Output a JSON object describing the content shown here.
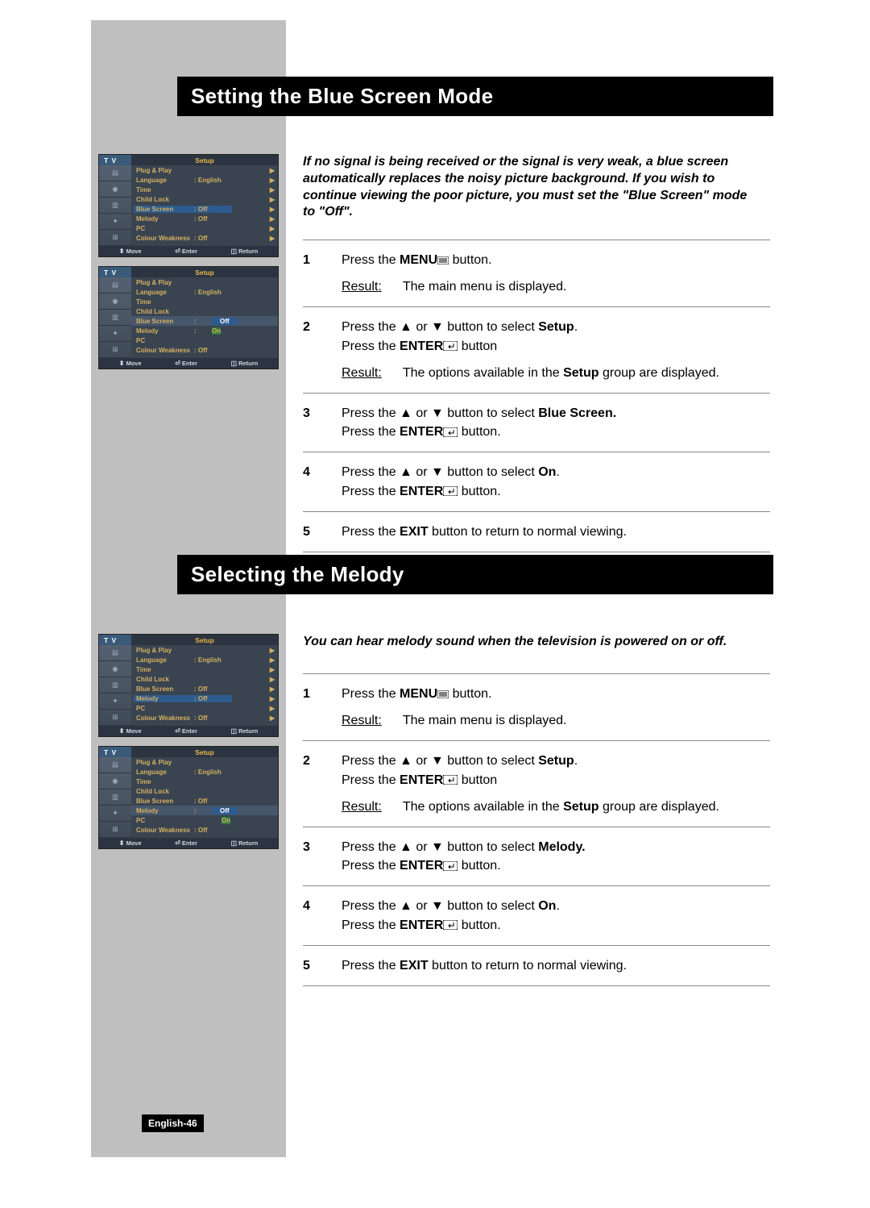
{
  "section1": {
    "title": "Setting the Blue Screen Mode",
    "intro": "If no signal is being received or the signal is very weak, a blue screen automatically replaces the noisy picture background.\nIf you wish to continue viewing the poor picture, you must set the \"Blue Screen\" mode to \"Off\".",
    "steps": {
      "s1_a": "Press the ",
      "s1_menu": "MENU",
      "s1_b": " button.",
      "s1_result_label": "Result",
      "s1_result": "The main menu is displayed.",
      "s2_a": "Press the ▲ or ▼ button to select ",
      "s2_setup": "Setup",
      "s2_b": ".\nPress the ",
      "s2_enter": "ENTER",
      "s2_c": " button",
      "s2_result_label": "Result",
      "s2_result_a": "The options available in the ",
      "s2_result_b": "Setup",
      "s2_result_c": " group are displayed.",
      "s3_a": "Press the ▲ or ▼ button to select ",
      "s3_b": "Blue Screen.",
      "s3_c": "\nPress the ",
      "s3_enter": "ENTER",
      "s3_d": " button.",
      "s4_a": "Press the ▲ or ▼ button to select ",
      "s4_b": "On",
      "s4_c": ".\nPress the ",
      "s4_enter": "ENTER",
      "s4_d": " button.",
      "s5_a": "Press the ",
      "s5_b": "EXIT",
      "s5_c": " button to return to normal viewing."
    }
  },
  "section2": {
    "title": "Selecting the Melody",
    "intro": "You can hear melody sound when the television is powered on or off.",
    "steps": {
      "s1_a": "Press the ",
      "s1_menu": "MENU",
      "s1_b": " button.",
      "s1_result_label": "Result",
      "s1_result": "The main menu is displayed.",
      "s2_a": "Press the ▲ or ▼ button to select ",
      "s2_setup": "Setup",
      "s2_b": ".\nPress the ",
      "s2_enter": "ENTER",
      "s2_c": " button",
      "s2_result_label": "Result",
      "s2_result_a": "The options available in the ",
      "s2_result_b": "Setup",
      "s2_result_c": " group are displayed.",
      "s3_a": "Press the ▲ or ▼ button to select ",
      "s3_b": "Melody.",
      "s3_c": "\nPress the ",
      "s3_enter": "ENTER",
      "s3_d": " button.",
      "s4_a": "Press the ▲ or ▼ button to select ",
      "s4_b": "On",
      "s4_c": ".\nPress the ",
      "s4_enter": "ENTER",
      "s4_d": " button.",
      "s5_a": "Press the ",
      "s5_b": "EXIT",
      "s5_c": " button to return to normal viewing."
    }
  },
  "osd": {
    "tv": "T V",
    "setup": "Setup",
    "rows": {
      "plugplay": "Plug & Play",
      "language": "Language",
      "language_val": ": English",
      "time": "Time",
      "childlock": "Child Lock",
      "bluescreen": "Blue Screen",
      "bluescreen_val": ": Off",
      "melody": "Melody",
      "melody_val": ": Off",
      "pc": "PC",
      "colourweakness": "Colour Weakness",
      "cw_val": ": Off",
      "off": "Off",
      "on": "On"
    },
    "ftr": {
      "move": "Move",
      "enter": "Enter",
      "return": "Return"
    }
  },
  "page_num": "English-46",
  "step_nums": {
    "n1": "1",
    "n2": "2",
    "n3": "3",
    "n4": "4",
    "n5": "5"
  }
}
